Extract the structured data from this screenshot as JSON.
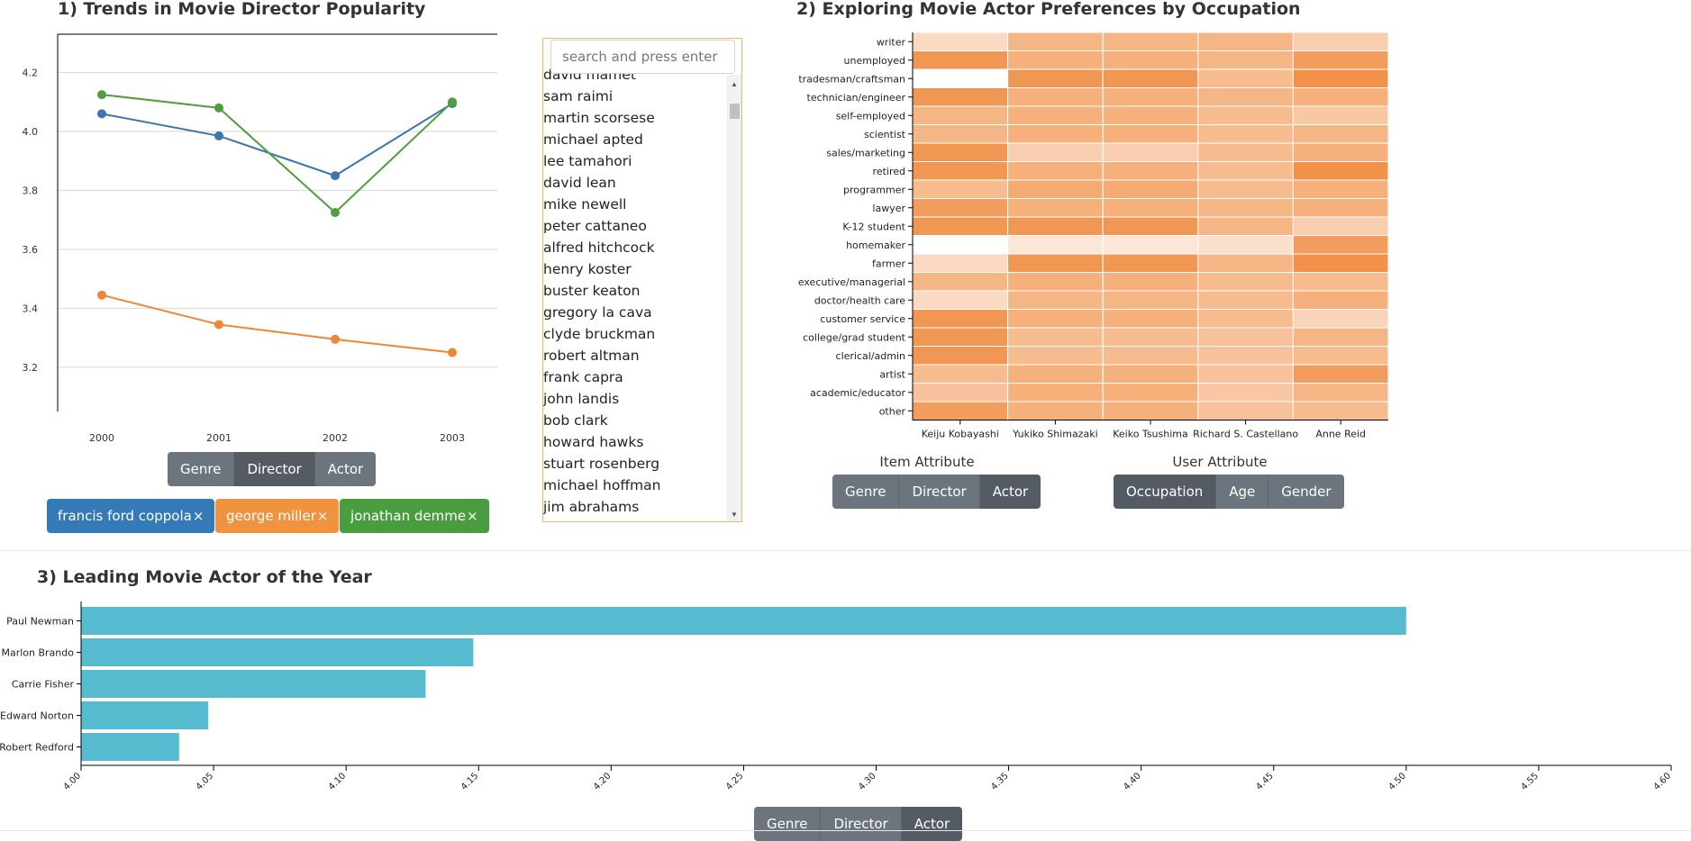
{
  "sections": {
    "s1_title": "1) Trends in Movie Director Popularity",
    "s2_title": "2) Exploring Movie Actor Preferences by Occupation",
    "s3_title": "3) Leading Movie Actor of the Year"
  },
  "colors": {
    "blue": "#3b75af",
    "orange": "#ef8536",
    "green": "#519e3e",
    "bar": "#56bbce",
    "chip_blue": "#337ab7",
    "chip_orange": "#f0933e",
    "chip_green": "#4a9d3f"
  },
  "s1_buttons": [
    {
      "label": "Genre",
      "active": false
    },
    {
      "label": "Director",
      "active": true
    },
    {
      "label": "Actor",
      "active": false
    }
  ],
  "chips": [
    {
      "label": "francis ford coppola",
      "close": "×",
      "color": "blue"
    },
    {
      "label": "george miller",
      "close": "×",
      "color": "orange"
    },
    {
      "label": "jonathan demme",
      "close": "×",
      "color": "green"
    }
  ],
  "director_search": {
    "placeholder": "search and press enter"
  },
  "director_list": [
    "david mamet",
    "sam raimi",
    "martin scorsese",
    "michael apted",
    "lee tamahori",
    "david lean",
    "mike newell",
    "peter cattaneo",
    "alfred hitchcock",
    "henry koster",
    "buster keaton",
    "gregory la cava",
    "clyde bruckman",
    "robert altman",
    "frank capra",
    "john landis",
    "bob clark",
    "howard hawks",
    "stuart rosenberg",
    "michael hoffman",
    "jim abrahams"
  ],
  "item_attribute": {
    "label": "Item Attribute",
    "buttons": [
      {
        "label": "Genre",
        "active": false
      },
      {
        "label": "Director",
        "active": false
      },
      {
        "label": "Actor",
        "active": true
      }
    ]
  },
  "user_attribute": {
    "label": "User Attribute",
    "buttons": [
      {
        "label": "Occupation",
        "active": true
      },
      {
        "label": "Age",
        "active": false
      },
      {
        "label": "Gender",
        "active": false
      }
    ]
  },
  "s3_buttons": [
    {
      "label": "Genre",
      "active": false
    },
    {
      "label": "Director",
      "active": false
    },
    {
      "label": "Actor",
      "active": true
    }
  ],
  "chart_data": [
    {
      "type": "line",
      "x": [
        "2000",
        "2001",
        "2002",
        "2003"
      ],
      "series": [
        {
          "name": "francis ford coppola",
          "color": "blue",
          "values": [
            4.06,
            3.985,
            3.85,
            4.095
          ]
        },
        {
          "name": "george miller",
          "color": "orange",
          "values": [
            3.445,
            3.345,
            3.295,
            3.25
          ]
        },
        {
          "name": "jonathan demme",
          "color": "green",
          "values": [
            4.125,
            4.08,
            3.725,
            4.1
          ]
        }
      ],
      "ylim": [
        3.05,
        4.33
      ],
      "yticks": [
        "3.2",
        "3.4",
        "3.6",
        "3.8",
        "4.0",
        "4.2"
      ],
      "grid": true
    },
    {
      "type": "heatmap",
      "x": [
        "Keiju Kobayashi",
        "Yukiko Shimazaki",
        "Keiko Tsushima",
        "Richard S. Castellano",
        "Anne Reid"
      ],
      "y": [
        "writer",
        "unemployed",
        "tradesman/craftsman",
        "technician/engineer",
        "self-employed",
        "scientist",
        "sales/marketing",
        "retired",
        "programmer",
        "lawyer",
        "K-12 student",
        "homemaker",
        "farmer",
        "executive/managerial",
        "doctor/health care",
        "customer service",
        "college/grad student",
        "clerical/admin",
        "artist",
        "academic/educator",
        "other"
      ],
      "values": [
        [
          0.3,
          0.6,
          0.6,
          0.6,
          0.4
        ],
        [
          0.85,
          0.65,
          0.65,
          0.6,
          0.8
        ],
        [
          0.0,
          0.85,
          0.85,
          0.55,
          0.9
        ],
        [
          0.85,
          0.65,
          0.65,
          0.6,
          0.65
        ],
        [
          0.6,
          0.65,
          0.65,
          0.55,
          0.45
        ],
        [
          0.6,
          0.65,
          0.65,
          0.55,
          0.6
        ],
        [
          0.85,
          0.4,
          0.4,
          0.55,
          0.65
        ],
        [
          0.85,
          0.65,
          0.65,
          0.55,
          0.9
        ],
        [
          0.55,
          0.7,
          0.7,
          0.55,
          0.65
        ],
        [
          0.8,
          0.65,
          0.65,
          0.6,
          0.65
        ],
        [
          0.85,
          0.85,
          0.85,
          0.6,
          0.4
        ],
        [
          0.0,
          0.2,
          0.2,
          0.25,
          0.8
        ],
        [
          0.3,
          0.85,
          0.85,
          0.6,
          0.9
        ],
        [
          0.6,
          0.65,
          0.65,
          0.55,
          0.55
        ],
        [
          0.3,
          0.6,
          0.6,
          0.55,
          0.65
        ],
        [
          0.85,
          0.65,
          0.65,
          0.55,
          0.35
        ],
        [
          0.85,
          0.55,
          0.55,
          0.5,
          0.6
        ],
        [
          0.85,
          0.55,
          0.55,
          0.5,
          0.55
        ],
        [
          0.55,
          0.65,
          0.65,
          0.5,
          0.8
        ],
        [
          0.5,
          0.65,
          0.65,
          0.45,
          0.6
        ],
        [
          0.8,
          0.65,
          0.65,
          0.5,
          0.55
        ]
      ]
    },
    {
      "type": "bar",
      "orientation": "horizontal",
      "categories": [
        "Paul Newman",
        "Marlon Brando",
        "Carrie Fisher",
        "Edward Norton",
        "Robert Redford"
      ],
      "values": [
        4.5,
        4.148,
        4.13,
        4.048,
        4.037
      ],
      "xlim": [
        4.0,
        4.6
      ],
      "xticks": [
        "4.00",
        "4.05",
        "4.10",
        "4.15",
        "4.20",
        "4.25",
        "4.30",
        "4.35",
        "4.40",
        "4.45",
        "4.50",
        "4.55",
        "4.60"
      ]
    }
  ]
}
